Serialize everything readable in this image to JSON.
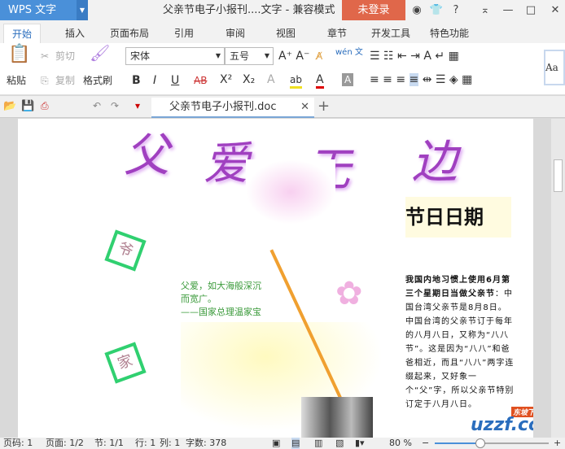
{
  "titlebar": {
    "app": "WPS 文字",
    "document_title": "父亲节电子小报刊....文字 - 兼容模式",
    "login": "未登录",
    "help": "?"
  },
  "menu_tabs": [
    "开始",
    "插入",
    "页面布局",
    "引用",
    "审阅",
    "视图",
    "章节",
    "开发工具",
    "特色功能"
  ],
  "ribbon": {
    "paste": "粘贴",
    "cut": "剪切",
    "copy": "复制",
    "format_painter": "格式刷",
    "font": "宋体",
    "size": "五号",
    "bold": "B",
    "italic": "I",
    "underline": "U",
    "strike": "AB",
    "sup": "X²",
    "sub": "X₂",
    "style_preview": "Aa",
    "pinyin": "wén 文"
  },
  "doc_tab": {
    "name": "父亲节电子小报刊.doc"
  },
  "document": {
    "headline": [
      "父",
      "爱",
      "无",
      "边"
    ],
    "holiday_heading": "节日日期",
    "quote": [
      "父爱，如大海般深沉",
      "而宽广。",
      "——国家总理温家宝"
    ],
    "box_chars": [
      "爷",
      "家"
    ],
    "body_bold": "我国内地习惯上使用6月第三个星期日当做父亲节",
    "body": "：中国台湾父亲节是8月8日。中国台湾的父亲节订于每年的八月八日，又称为“八八节”。这是因为“八八”和爸爸相近，而且“八八”两字连缀起来，又好象一个“父”字，所以父亲节特别订定于八月八日。",
    "watermark": "uzzf.com",
    "watermark_sub": "东坡下载"
  },
  "status": {
    "page_no": "页码: 1",
    "pages": "页面: 1/2",
    "section": "节: 1/1",
    "row": "行: 1",
    "col": "列: 1",
    "words": "字数: 378",
    "zoom": "80 %",
    "zoom_percent": 80
  },
  "colors": {
    "brand": "#4a90d9",
    "login": "#e0674a",
    "headline": "#a040c0",
    "quote": "#3a9a3a"
  }
}
